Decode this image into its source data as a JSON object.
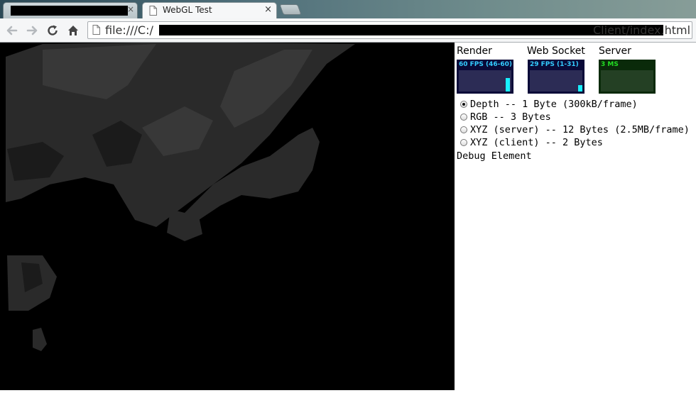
{
  "browser": {
    "active_tab_title": "WebGL Test",
    "close_glyph": "×",
    "url_prefix": "file:///C:/",
    "url_suffix": "Client/index.html"
  },
  "stats": {
    "render": {
      "label": "Render",
      "value": "60 FPS (46-60)",
      "bar_fraction": 0.65
    },
    "websocket": {
      "label": "Web Socket",
      "value": "29 FPS (1-31)",
      "bar_fraction": 0.3
    },
    "server": {
      "label": "Server",
      "value": "3 MS"
    }
  },
  "options": [
    {
      "label": "Depth -- 1 Byte (300kB/frame)",
      "checked": true
    },
    {
      "label": "RGB -- 3 Bytes",
      "checked": false
    },
    {
      "label": "XYZ (server) -- 12 Bytes (2.5MB/frame)",
      "checked": false
    },
    {
      "label": "XYZ (client) -- 2 Bytes",
      "checked": false
    }
  ],
  "debug_label": "Debug Element",
  "colors": {
    "viewport_bg": "#000000",
    "depth_gray": "#2a2a2a",
    "fps_bar": "#18f0ff",
    "server_text": "#22dd22"
  }
}
